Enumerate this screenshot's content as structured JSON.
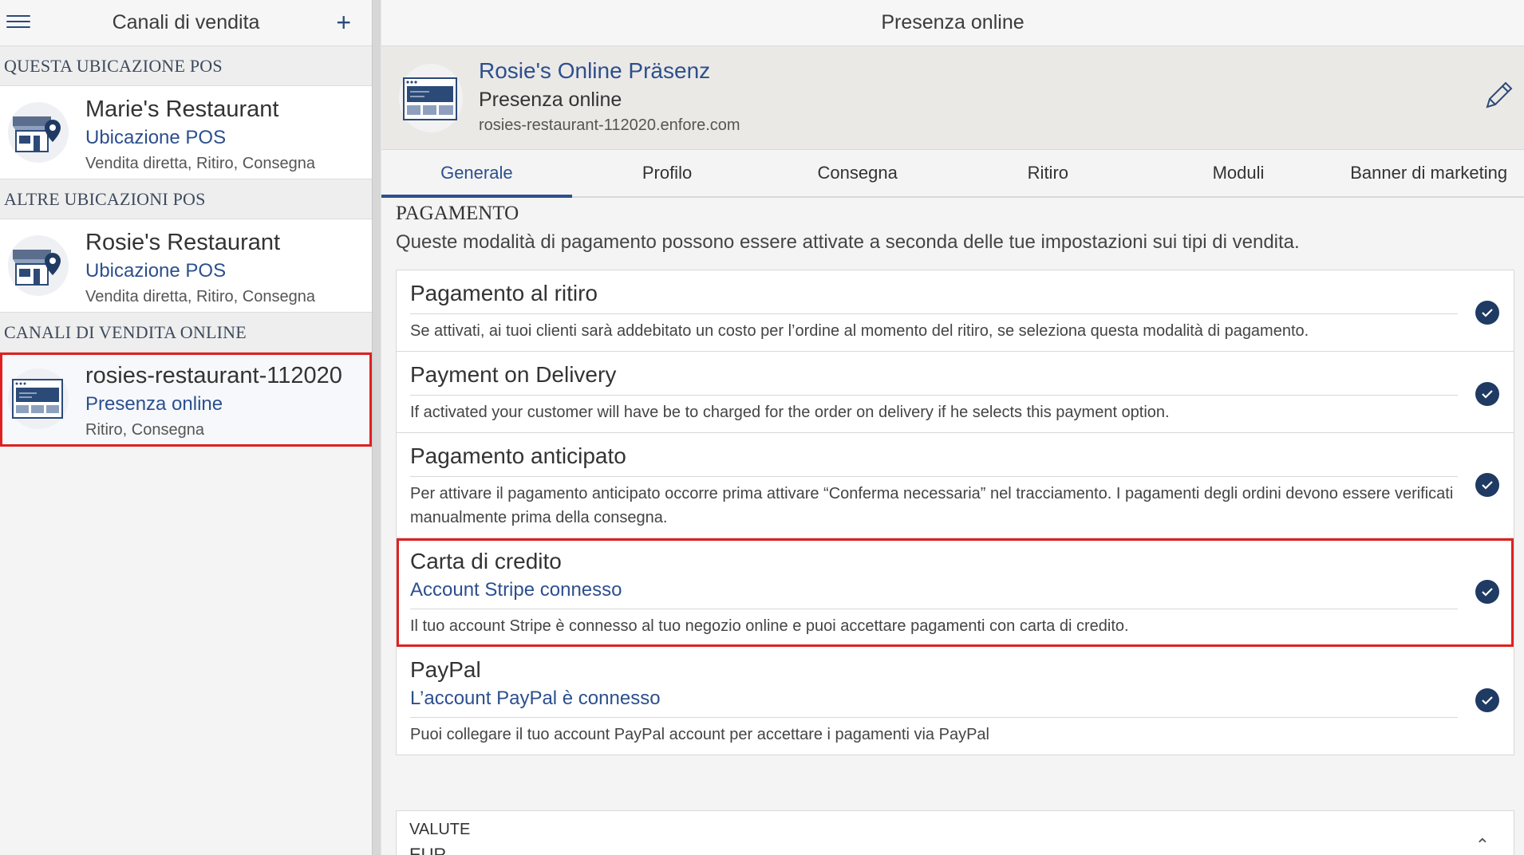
{
  "left_panel": {
    "title": "Canali di vendita",
    "add_label": "+",
    "sections": [
      {
        "title": "QUESTA UBICAZIONE POS",
        "items": [
          {
            "name": "Marie's Restaurant",
            "type": "Ubicazione POS",
            "desc": "Vendita diretta, Ritiro, Consegna"
          }
        ]
      },
      {
        "title": "ALTRE UBICAZIONI POS",
        "items": [
          {
            "name": "Rosie's Restaurant",
            "type": "Ubicazione POS",
            "desc": "Vendita diretta, Ritiro, Consegna"
          }
        ]
      },
      {
        "title": "CANALI DI VENDITA ONLINE",
        "items": [
          {
            "name": "rosies-restaurant-112020",
            "type": "Presenza online",
            "desc": "Ritiro, Consegna"
          }
        ]
      }
    ]
  },
  "right_panel": {
    "title": "Presenza online",
    "hero": {
      "title": "Rosie's Online Präsenz",
      "subtitle": "Presenza online",
      "url": "rosies-restaurant-112020.enfore.com"
    },
    "tabs": [
      "Generale",
      "Profilo",
      "Consegna",
      "Ritiro",
      "Moduli",
      "Banner di marketing"
    ],
    "active_tab": "Generale",
    "payment": {
      "heading": "PAGAMENTO",
      "description": "Queste modalità di pagamento possono essere attivate a seconda delle tue impostazioni sui tipi di vendita.",
      "methods": [
        {
          "title": "Pagamento al ritiro",
          "status": "",
          "text": "Se attivati, ai tuoi clienti sarà addebitato un costo per l’ordine al momento del ritiro, se seleziona questa modalità di pagamento."
        },
        {
          "title": "Payment on Delivery",
          "status": "",
          "text": "If activated your customer will have be to charged for the order on delivery if he selects this payment option."
        },
        {
          "title": "Pagamento anticipato",
          "status": "",
          "text": "Per attivare il pagamento anticipato occorre prima attivare “Conferma necessaria” nel tracciamento. I pagamenti degli ordini devono essere verificati manualmente prima della consegna."
        },
        {
          "title": "Carta di credito",
          "status": "Account Stripe connesso",
          "text": "Il tuo account Stripe è connesso al tuo negozio online e puoi accettare pagamenti con carta di credito."
        },
        {
          "title": "PayPal",
          "status": "L’account PayPal è connesso",
          "text": "Puoi collegare il tuo account PayPal account per accettare i pagamenti via PayPal"
        }
      ]
    },
    "currency": {
      "label": "VALUTE",
      "value": "EUR"
    }
  },
  "colors": {
    "accent": "#2c4f8e",
    "highlight": "#e02020",
    "check": "#1f3a63"
  }
}
